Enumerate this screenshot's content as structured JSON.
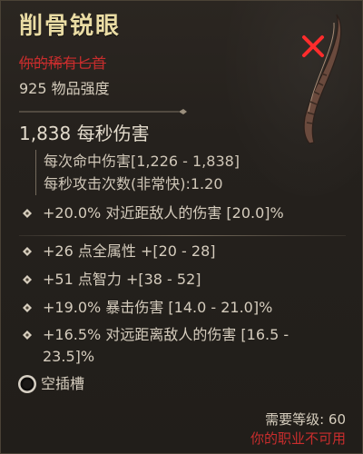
{
  "item": {
    "name": "削骨锐眼",
    "type_label": "你的稀有匕首",
    "item_power": "925 物品强度"
  },
  "weapon_stats": {
    "dps": "1,838 每秒伤害",
    "damage_per_hit": "每次命中伤害[1,226 - 1,838]",
    "attacks_per_second": "每秒攻击次数(非常快):1.20",
    "implicit": "+20.0% 对近距敌人的伤害 [20.0]%"
  },
  "affixes": [
    "+26 点全属性 +[20 - 28]",
    "+51 点智力 +[38 - 52]",
    "+19.0% 暴击伤害 [14.0 - 21.0]%",
    "+16.5% 对远距离敌人的伤害 [16.5 - 23.5]%"
  ],
  "socket": {
    "label": "空插槽"
  },
  "requirements": {
    "level": "需要等级: 60",
    "class_warning": "你的职业不可用"
  },
  "icons": {
    "affix_bullet": "diamond-bullet-icon",
    "socket": "empty-socket-icon",
    "weapon": "dagger-icon",
    "unusable_mark": "red-x-icon"
  },
  "colors": {
    "item_name": "#eadca4",
    "rarity_warning": "#c92d2d",
    "body_text": "#d5ccbd",
    "background": "#25211d"
  }
}
